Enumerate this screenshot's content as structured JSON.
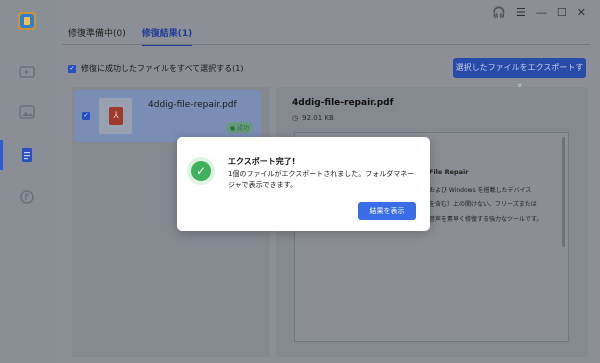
{
  "window": {
    "icons": [
      "headset-icon",
      "menu-icon",
      "minimize-icon",
      "maximize-icon",
      "close-icon"
    ]
  },
  "sidebar": {
    "items": [
      "app-logo-icon",
      "video-icon",
      "image-icon",
      "document-icon",
      "audio-icon"
    ],
    "active": "document-icon"
  },
  "tabs": [
    {
      "label": "修復準備中(0)",
      "active": false
    },
    {
      "label": "修復結果(1)",
      "active": true
    }
  ],
  "select_all": {
    "label": "修復に成功したファイルをすべて選択する(1)",
    "checked": true
  },
  "export_button": {
    "label": "選択したファイルをエクスポートする"
  },
  "file_list": [
    {
      "name": "4ddig-file-repair.pdf",
      "status": "成功",
      "checked": true
    }
  ],
  "preview": {
    "title": "4ddig-file-repair.pdf",
    "size": "92.01 KB",
    "lines": [
      "File Repair",
      "および Windows を搭載したデバイス",
      "を含む）上の開けない、フリーズまたは",
      "音声を素早く修復する強力なツールです。"
    ]
  },
  "dialog": {
    "title": "エクスポート完了!",
    "message": "1個のファイルがエクスポートされました。フォルダマネージャで表示できます。",
    "button": "結果を表示"
  },
  "colors": {
    "accent": "#3a6ee6",
    "success": "#3eb15b"
  }
}
